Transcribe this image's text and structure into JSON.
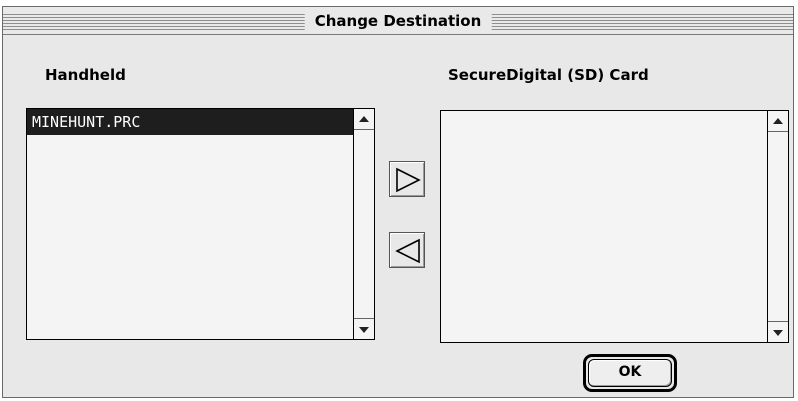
{
  "window": {
    "title": "Change Destination"
  },
  "handheld": {
    "label": "Handheld",
    "items": [
      "MINEHUNT.PRC"
    ],
    "selected_item": "MINEHUNT.PRC"
  },
  "card": {
    "label": "SecureDigital (SD) Card",
    "items": []
  },
  "buttons": {
    "ok_label": "OK"
  },
  "icons": {
    "move_right": "triangle-right-icon",
    "move_left": "triangle-left-icon",
    "scroll_up": "scroll-up-arrow-icon",
    "scroll_down": "scroll-down-arrow-icon"
  },
  "colors": {
    "selection": "#1e1e1e",
    "window_bg": "#e8e8e8"
  }
}
